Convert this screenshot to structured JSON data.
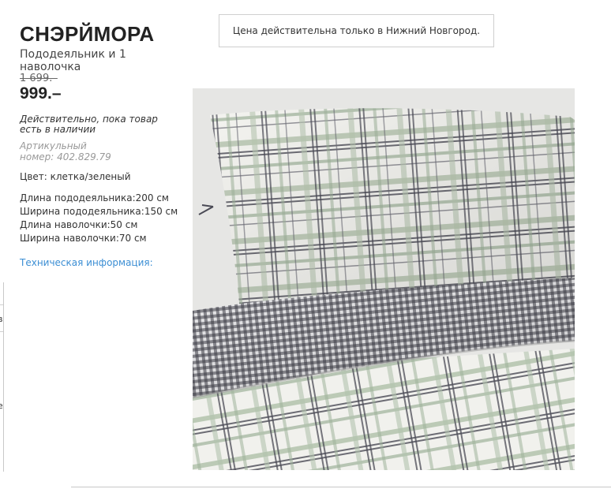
{
  "product": {
    "name": "СНЭРЙМОРА",
    "description": "Пододеяльник и 1 наволочка",
    "old_price": "1 699.–",
    "new_price": "999.–",
    "validity": "Действительно, пока товар есть в наличии",
    "article": "Артикульный номер: 402.829.79",
    "color": "Цвет: клетка/зеленый",
    "specs": [
      "Длина пододеяльника:200 см",
      "Ширина пододеяльника:150 см",
      "Длина наволочки:50 см",
      "Ширина наволочки:70 см"
    ],
    "tech_info_link": "Техническая информация:",
    "image_icon": "bedding-photo"
  },
  "price_notice": "Цена действительна только в Нижний Новгород.",
  "edge_marks": [
    "в",
    "|",
    "е",
    "|"
  ],
  "colors": {
    "link": "#3b8ed4",
    "plaid_green": "#9fb39a",
    "plaid_dark": "#4a4a55",
    "gingham_dark": "#3c3c45"
  }
}
